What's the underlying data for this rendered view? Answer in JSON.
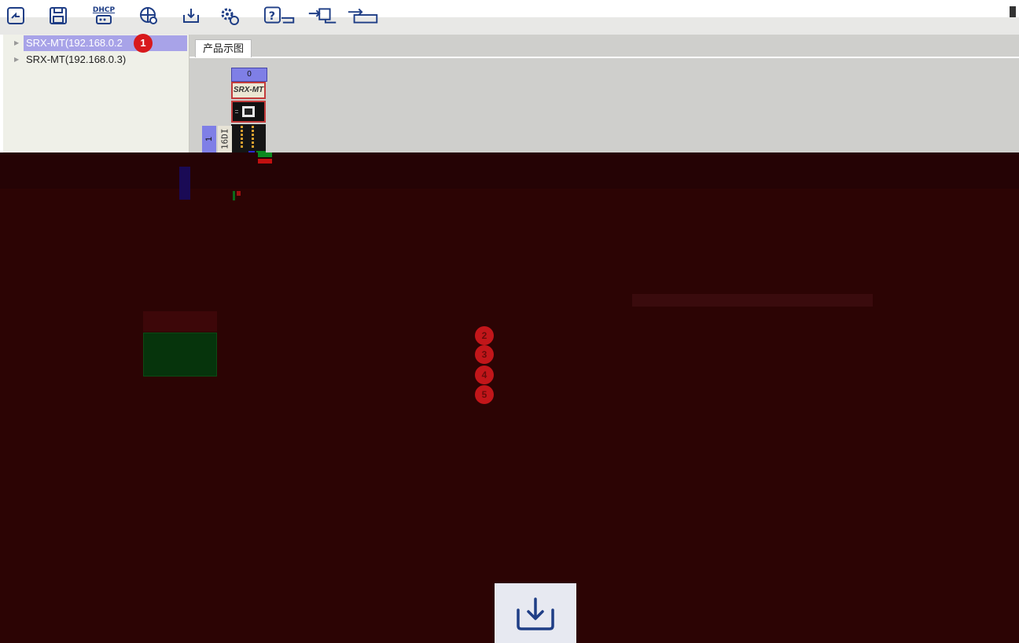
{
  "toolbar": {
    "icons": [
      "open-project-icon",
      "save-icon",
      "dhcp-icon",
      "network-search-icon",
      "download-icon",
      "settings-icon",
      "help-icon",
      "device-connect-icon",
      "device-transfer-icon"
    ],
    "dhcp_label": "DHCP"
  },
  "tree": {
    "items": [
      {
        "label": "SRX-MT(192.168.0.2",
        "selected": true
      },
      {
        "label": "SRX-MT(192.168.0.3)",
        "selected": false
      }
    ],
    "badge": "1"
  },
  "main": {
    "tab_label": "产品示图",
    "device": {
      "index": "0",
      "name": "SRX-MT",
      "module_index": "1",
      "module_label": "16DI"
    }
  },
  "overlay": {
    "badges": [
      "2",
      "3",
      "4",
      "5"
    ]
  },
  "colors": {
    "selection": "#a8a3e8",
    "badge_red": "#d8191c",
    "overlay": "#2c0404",
    "module_index_bg": "#7f7fe6"
  }
}
